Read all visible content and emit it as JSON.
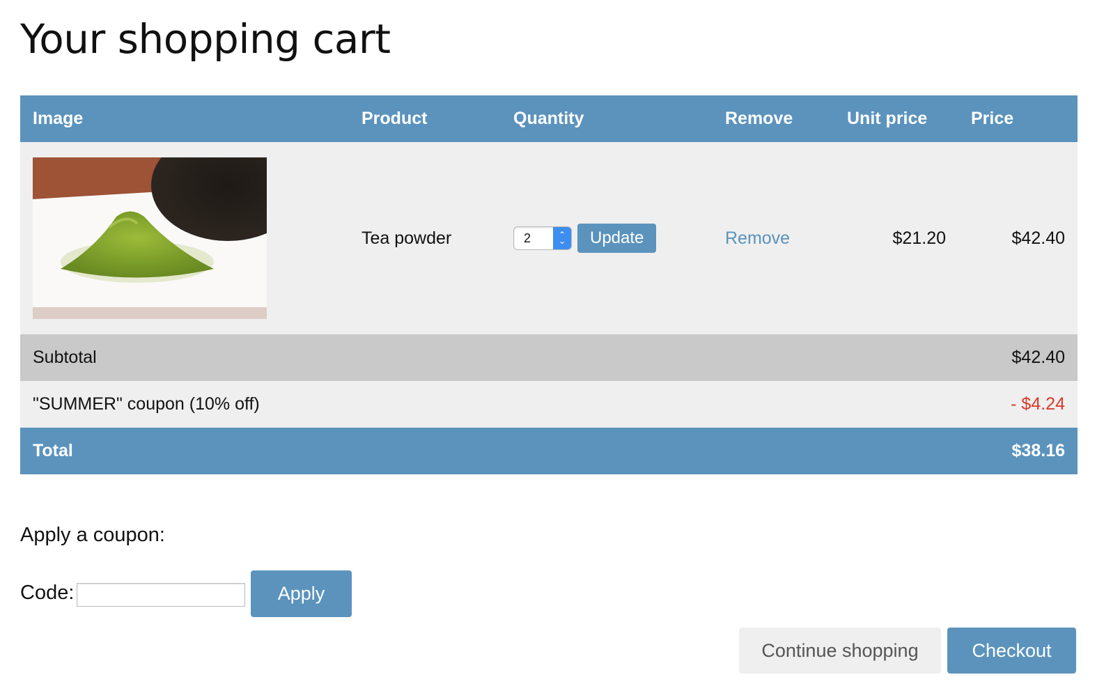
{
  "page": {
    "title": "Your shopping cart"
  },
  "table": {
    "headers": {
      "image": "Image",
      "product": "Product",
      "quantity": "Quantity",
      "remove": "Remove",
      "unit_price": "Unit price",
      "price": "Price"
    },
    "items": [
      {
        "image_icon": "tea-powder-photo",
        "product": "Tea powder",
        "quantity": "2",
        "update_label": "Update",
        "remove_label": "Remove",
        "unit_price": "$21.20",
        "price": "$42.40"
      }
    ],
    "subtotal": {
      "label": "Subtotal",
      "value": "$42.40"
    },
    "coupon": {
      "label": "\"SUMMER\" coupon (10% off)",
      "value": "- $4.24"
    },
    "total": {
      "label": "Total",
      "value": "$38.16"
    }
  },
  "coupon_form": {
    "heading": "Apply a coupon:",
    "code_label": "Code:",
    "code_value": "",
    "apply_label": "Apply"
  },
  "actions": {
    "continue_label": "Continue shopping",
    "checkout_label": "Checkout"
  },
  "colors": {
    "accent": "#5b93bd",
    "discount": "#d9392a",
    "row_light": "#efefef",
    "row_subtotal": "#c9c9c9"
  }
}
